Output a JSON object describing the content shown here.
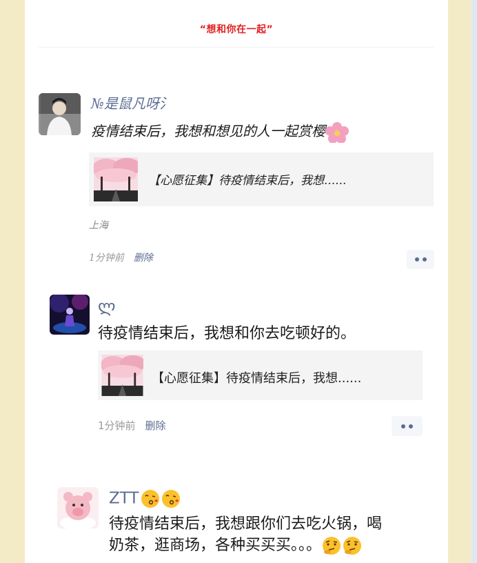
{
  "header": {
    "title": "“想和你在一起”"
  },
  "posts": [
    {
      "nickname": "№是鼠凡呀氵",
      "text": "疫情结束后，我想和想见的人一起赏樱",
      "link_title": "【心愿征集】待疫情结束后，我想......",
      "location": "上海",
      "time": "1分钟前",
      "delete_label": "删除",
      "emoji": "cherry-blossom"
    },
    {
      "nickname": "ლ",
      "text": "待疫情结束后，我想和你去吃顿好的。",
      "link_title": "【心愿征集】待疫情结束后，我想......",
      "time": "1分钟前",
      "delete_label": "删除"
    },
    {
      "nickname": "ZTT",
      "nickname_emoji": [
        "kissing-face",
        "kissing-face"
      ],
      "text_line1": "待疫情结束后，我想跟你们去吃火锅，喝",
      "text_line2": "奶茶，逛商场，各种买买买。。。",
      "text_emoji": [
        "thinking-face",
        "thinking-face"
      ]
    }
  ],
  "colors": {
    "background": "#f3ebc6",
    "header_red": "#e02020",
    "link_blue": "#5b6b91",
    "card_gray": "#f4f4f4"
  }
}
